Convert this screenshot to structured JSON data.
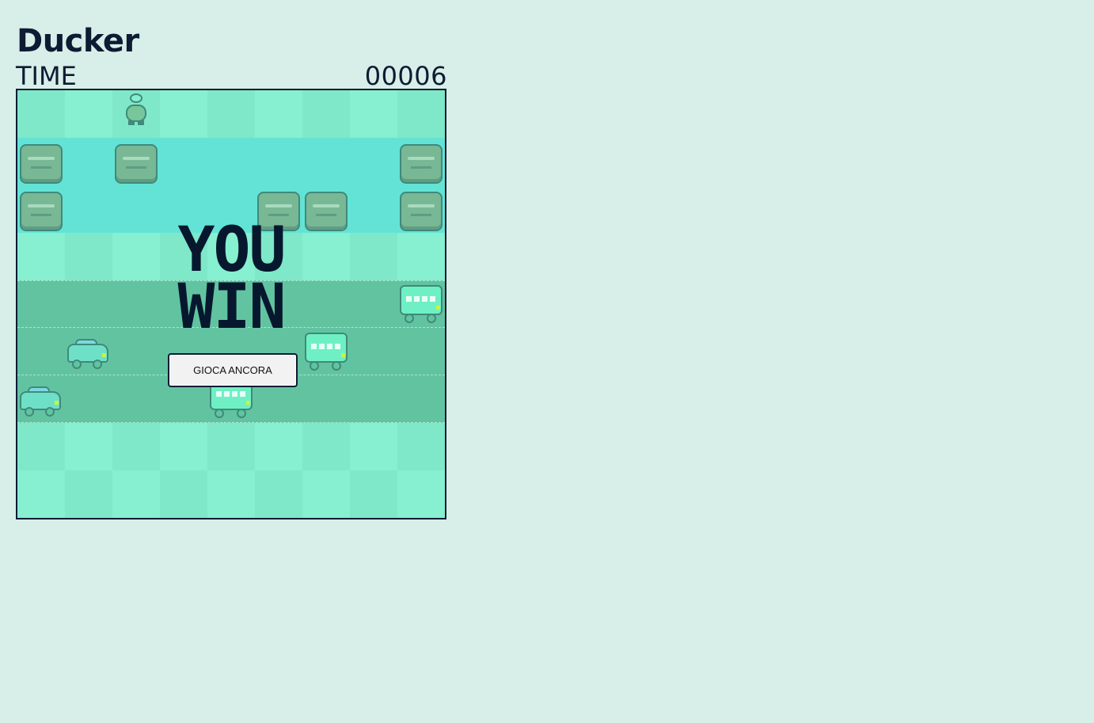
{
  "game": {
    "title": "Ducker",
    "time_label": "TIME",
    "time_value": "00006",
    "win_line1": "YOU",
    "win_line2": "WIN",
    "replay_label": "GIOCA ANCORA"
  },
  "colors": {
    "background": "#d8eee8",
    "text": "#0d1b33",
    "grass_light": "#86f0d0",
    "grass_dark": "#7ee8c8",
    "water": "#63e3d6",
    "road": "#62c3a1"
  },
  "lanes": [
    "grass",
    "water",
    "water",
    "grass",
    "road",
    "road",
    "road",
    "grass",
    "grass"
  ],
  "sprites": {
    "player": "duck-icon",
    "log": "log-icon",
    "car": "car-icon",
    "bus": "bus-icon"
  }
}
